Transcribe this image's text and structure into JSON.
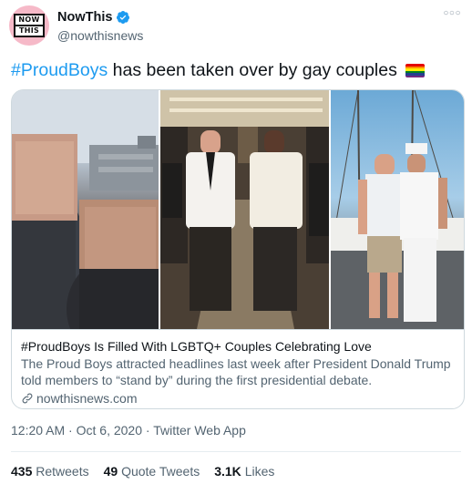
{
  "account": {
    "display_name": "NowThis",
    "handle": "@nowthisnews",
    "avatar_lines": [
      "NOW",
      "THIS"
    ],
    "verified": true
  },
  "tweet": {
    "hashtag": "#ProudBoys",
    "text_rest": " has been taken over by gay couples",
    "emoji": "rainbow-flag"
  },
  "card": {
    "title": "#ProudBoys Is Filled With LGBTQ+ Couples Celebrating Love",
    "description": "The Proud Boys attracted headlines last week after President Donald Trump told members to “stand by” during the first presidential debate.",
    "domain": "nowthisnews.com"
  },
  "meta": {
    "time": "12:20 AM",
    "sep1": " · ",
    "date": "Oct 6, 2020",
    "sep2": " · ",
    "app": "Twitter Web App"
  },
  "stats": {
    "retweets_count": "435",
    "retweets_label": "Retweets",
    "quotes_count": "49",
    "quotes_label": "Quote Tweets",
    "likes_count": "3.1K",
    "likes_label": "Likes"
  },
  "colors": {
    "link_blue": "#1d9bf0",
    "secondary_text": "#536471",
    "verified_blue": "#1d9bf0",
    "avatar_pink": "#f6b9c8"
  }
}
